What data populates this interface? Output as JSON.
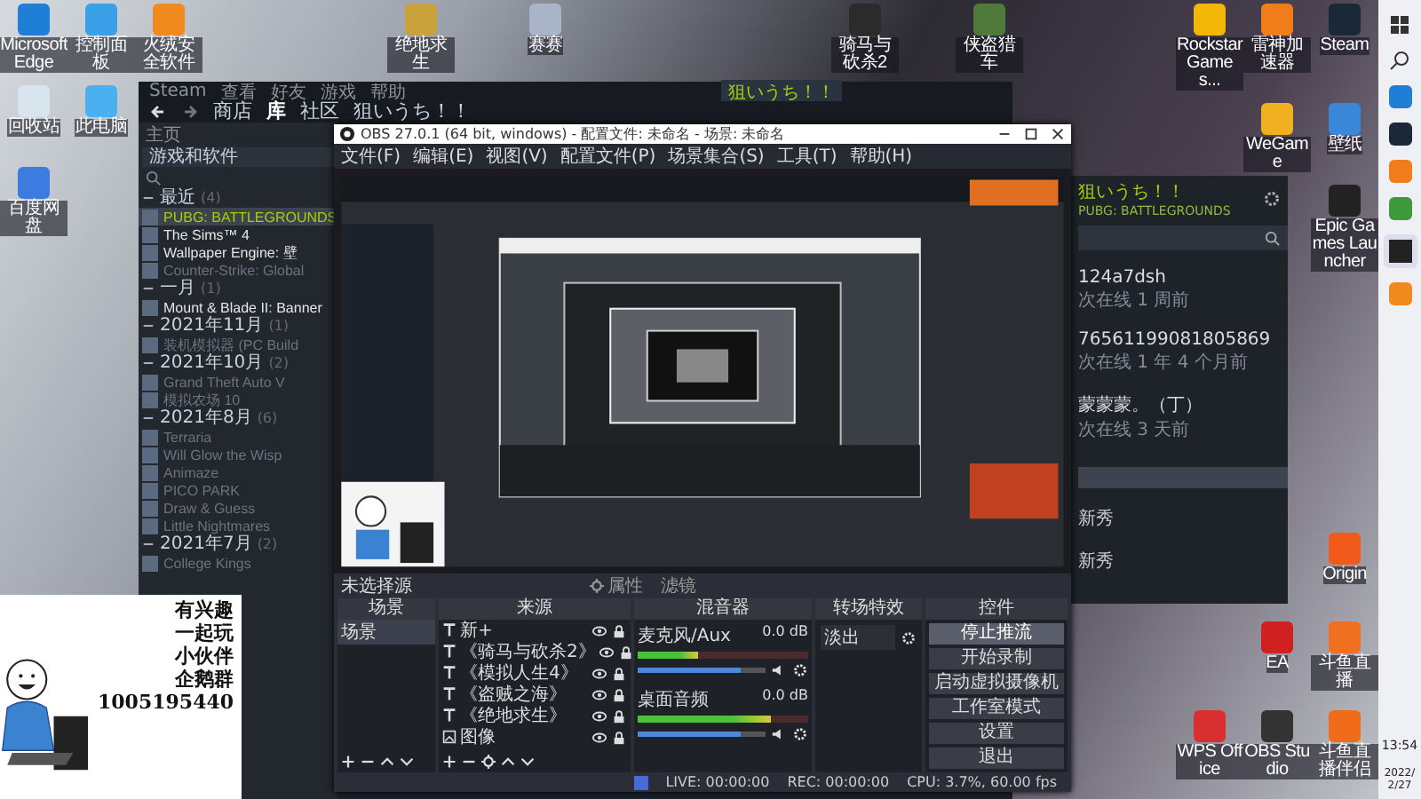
{
  "desktop_icons": [
    {
      "label": "Microsoft Edge"
    },
    {
      "label": "控制面板"
    },
    {
      "label": "火绒安全软件"
    },
    {
      "label": "回收站"
    },
    {
      "label": "此电脑"
    },
    {
      "label": "百度网盘"
    },
    {
      "label": "绝地求生"
    },
    {
      "label": "赛赛"
    },
    {
      "label": "骑马与砍杀2"
    },
    {
      "label": "侠盗猎车"
    },
    {
      "label": "Rockstar Games..."
    },
    {
      "label": "雷神加速器"
    },
    {
      "label": "Steam"
    },
    {
      "label": "WeGame"
    },
    {
      "label": "壁纸"
    },
    {
      "label": "Epic Games Launcher"
    },
    {
      "label": "Origin"
    },
    {
      "label": "EA"
    },
    {
      "label": "斗鱼直播"
    },
    {
      "label": "WPS Office"
    },
    {
      "label": "OBS Studio"
    },
    {
      "label": "斗鱼直播伴侣"
    }
  ],
  "steam": {
    "menu": [
      "Steam",
      "查看",
      "好友",
      "游戏",
      "帮助"
    ],
    "nav": [
      {
        "label": "商店",
        "selected": false
      },
      {
        "label": "库",
        "selected": true
      },
      {
        "label": "社区",
        "selected": false
      },
      {
        "label": "狙いうち！！",
        "selected": false
      }
    ],
    "home": "主页",
    "filter": "游戏和软件",
    "groups": [
      {
        "title": "最近",
        "count": "(4)",
        "games": [
          {
            "name": "PUBG: BATTLEGROUNDS",
            "installed": true,
            "selected": true
          },
          {
            "name": "The Sims™ 4",
            "installed": true,
            "selected": false
          },
          {
            "name": "Wallpaper Engine: 壁",
            "installed": true,
            "selected": false
          },
          {
            "name": "Counter-Strike: Global",
            "installed": false,
            "selected": false
          }
        ]
      },
      {
        "title": "一月",
        "count": "(1)",
        "games": [
          {
            "name": "Mount & Blade II: Banner",
            "installed": true,
            "selected": false
          }
        ]
      },
      {
        "title": "2021年11月",
        "count": "(1)",
        "games": [
          {
            "name": "装机模拟器 (PC Build",
            "installed": false,
            "selected": false
          }
        ]
      },
      {
        "title": "2021年10月",
        "count": "(2)",
        "games": [
          {
            "name": "Grand Theft Auto V",
            "installed": false,
            "selected": false
          },
          {
            "name": "模拟农场 10",
            "installed": false,
            "selected": false
          }
        ]
      },
      {
        "title": "2021年8月",
        "count": "(6)",
        "games": [
          {
            "name": "Terraria",
            "installed": false,
            "selected": false
          },
          {
            "name": "Will Glow the Wisp",
            "installed": false,
            "selected": false
          },
          {
            "name": "Animaze",
            "installed": false,
            "selected": false
          },
          {
            "name": "PICO PARK",
            "installed": false,
            "selected": false
          },
          {
            "name": "Draw & Guess",
            "installed": false,
            "selected": false
          },
          {
            "name": "Little Nightmares",
            "installed": false,
            "selected": false
          }
        ]
      },
      {
        "title": "2021年7月",
        "count": "(2)",
        "games": [
          {
            "name": "College Kings",
            "installed": false,
            "selected": false
          }
        ]
      }
    ],
    "user_chip": "狙いうち！！"
  },
  "friends": {
    "name": "狙いうち！！",
    "game": "PUBG: BATTLEGROUNDS",
    "list": [
      {
        "name": "124a7dsh",
        "status": "次在线 1 周前"
      },
      {
        "name": "76561199081805869",
        "status": "次在线 1 年 4 个月前"
      },
      {
        "name": "蒙蒙蒙。（丁）",
        "status": "次在线 3 天前"
      }
    ],
    "groups": [
      "新秀",
      "新秀"
    ]
  },
  "obs": {
    "title": "OBS 27.0.1 (64 bit, windows) - 配置文件: 未命名 - 场景: 未命名",
    "menu": [
      "文件(F)",
      "编辑(E)",
      "视图(V)",
      "配置文件(P)",
      "场景集合(S)",
      "工具(T)",
      "帮助(H)"
    ],
    "no_source": "未选择源",
    "props_button": "属性",
    "filters_button": "滤镜",
    "docks": {
      "scenes": "场景",
      "sources": "来源",
      "mixer": "混音器",
      "transitions": "转场特效",
      "controls": "控件"
    },
    "scenes": [
      {
        "name": "场景",
        "selected": true
      }
    ],
    "sources": [
      {
        "name": "新+",
        "kind": "text"
      },
      {
        "name": "《骑马与砍杀2》",
        "kind": "text"
      },
      {
        "name": "《模拟人生4》",
        "kind": "text"
      },
      {
        "name": "《盗贼之海》",
        "kind": "text"
      },
      {
        "name": "《绝地求生》",
        "kind": "text"
      },
      {
        "name": "图像",
        "kind": "image"
      }
    ],
    "channels": [
      {
        "name": "麦克风/Aux",
        "reading": "0.0 dB",
        "level": 0.35,
        "fader": {
          "level": 0.8
        }
      },
      {
        "name": "桌面音频",
        "reading": "0.0 dB",
        "level": 0.78,
        "fader": {
          "level": 0.8
        }
      }
    ],
    "transition": "淡出",
    "controls": [
      {
        "label": "停止推流",
        "active": true
      },
      {
        "label": "开始录制",
        "active": false
      },
      {
        "label": "启动虚拟摄像机",
        "active": false
      },
      {
        "label": "工作室模式",
        "active": false
      },
      {
        "label": "设置",
        "active": false
      },
      {
        "label": "退出",
        "active": false
      }
    ],
    "status": [
      "LIVE: 00:00:00",
      "REC: 00:00:00",
      "CPU: 3.7%, 60.00 fps"
    ]
  },
  "sticker": {
    "lines": [
      "有兴趣",
      "一起玩",
      "小伙伴",
      "企鹅群",
      "1005195440"
    ]
  },
  "clock": {
    "time": "13:54",
    "date": "2022/2/27"
  }
}
